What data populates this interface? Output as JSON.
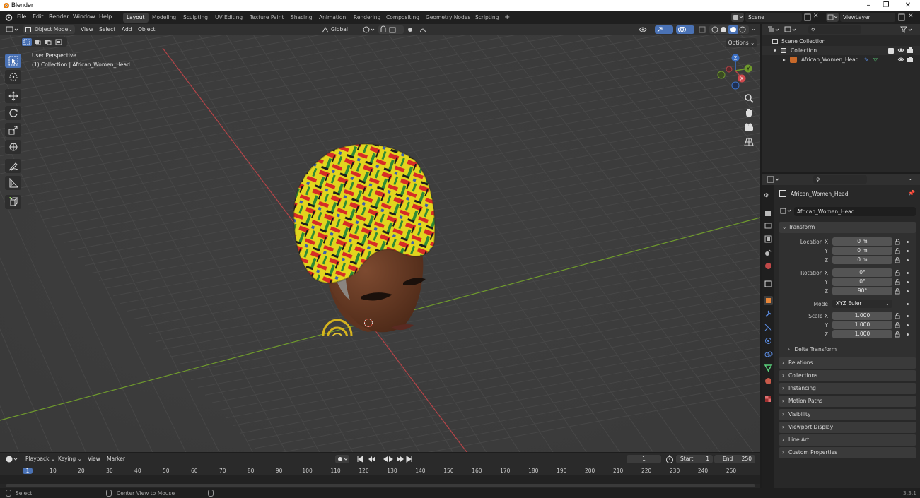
{
  "window": {
    "title": "Blender"
  },
  "menu": {
    "items": [
      "File",
      "Edit",
      "Render",
      "Window",
      "Help"
    ]
  },
  "workspaces": {
    "tabs": [
      "Layout",
      "Modeling",
      "Sculpting",
      "UV Editing",
      "Texture Paint",
      "Shading",
      "Animation",
      "Rendering",
      "Compositing",
      "Geometry Nodes",
      "Scripting"
    ],
    "active": "Layout",
    "add": "+"
  },
  "scene": {
    "name": "Scene"
  },
  "view_layer": {
    "name": "ViewLayer"
  },
  "viewport_header": {
    "mode": "Object Mode",
    "view": "View",
    "select": "Select",
    "add": "Add",
    "object": "Object",
    "orientation": "Global",
    "options": "Options"
  },
  "viewport": {
    "perspective": "User Perspective",
    "collection_info": "(1) Collection | African_Women_Head",
    "gizmo": {
      "x": "X",
      "y": "Y",
      "z": "Z"
    }
  },
  "outliner": {
    "search_placeholder": "",
    "rows": [
      {
        "label": "Scene Collection"
      },
      {
        "label": "Collection"
      },
      {
        "label": "African_Women_Head"
      }
    ]
  },
  "properties": {
    "object_name": "African_Women_Head",
    "data_name": "African_Women_Head",
    "transform": {
      "header": "Transform",
      "location_label": "Location X",
      "location": [
        "0 m",
        "0 m",
        "0 m"
      ],
      "rotation_label": "Rotation X",
      "rotation": [
        "0°",
        "0°",
        "90°"
      ],
      "mode_label": "Mode",
      "mode": "XYZ Euler",
      "scale_label": "Scale X",
      "scale": [
        "1.000",
        "1.000",
        "1.000"
      ],
      "axis_y": "Y",
      "axis_z": "Z",
      "delta": "Delta Transform"
    },
    "panels": [
      "Relations",
      "Collections",
      "Instancing",
      "Motion Paths",
      "Visibility",
      "Viewport Display",
      "Line Art",
      "Custom Properties"
    ]
  },
  "timeline": {
    "menus": [
      "Playback",
      "Keying",
      "View",
      "Marker"
    ],
    "current_frame": "1",
    "start_label": "Start",
    "start": "1",
    "end_label": "End",
    "end": "250",
    "ruler": [
      "1",
      "10",
      "20",
      "30",
      "40",
      "50",
      "60",
      "70",
      "80",
      "90",
      "100",
      "110",
      "120",
      "130",
      "140",
      "150",
      "160",
      "170",
      "180",
      "190",
      "200",
      "210",
      "220",
      "230",
      "240",
      "250"
    ]
  },
  "statusbar": {
    "select": "Select",
    "center_view": "Center View to Mouse",
    "version": "3.3.1"
  },
  "colors": {
    "active_blue": "#4a72b5",
    "x_axis": "#b54448",
    "y_axis": "#6f9a2d",
    "z_axis": "#3b6fc4",
    "frame_blue": "#4a72b5"
  }
}
